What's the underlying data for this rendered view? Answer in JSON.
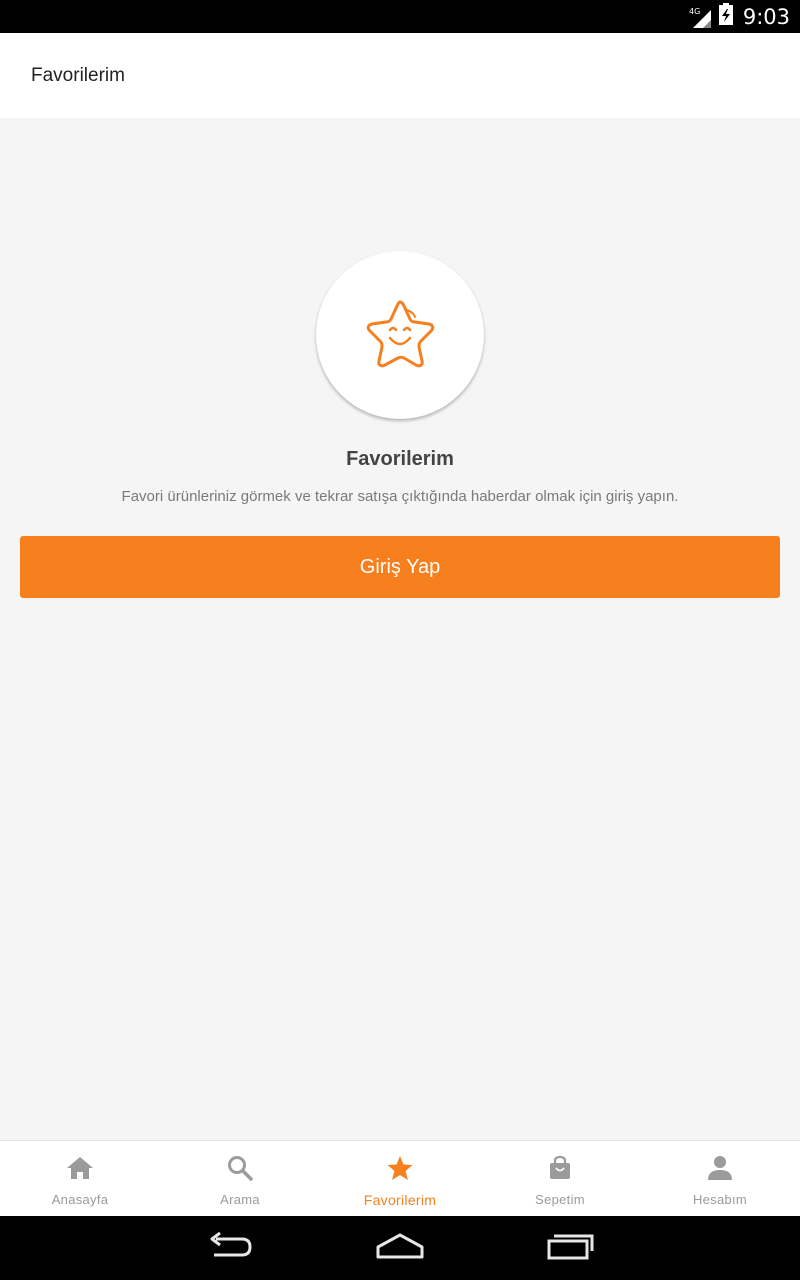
{
  "status_bar": {
    "network": "4G",
    "time": "9:03"
  },
  "app_bar": {
    "title": "Favorilerim"
  },
  "empty_state": {
    "icon": "smiling-star-icon",
    "title": "Favorilerim",
    "description": "Favori ürünleriniz görmek ve tekrar satışa çıktığında haberdar olmak için giriş yapın.",
    "button_label": "Giriş Yap"
  },
  "bottom_nav": {
    "items": [
      {
        "label": "Anasayfa",
        "icon": "home-icon",
        "active": false
      },
      {
        "label": "Arama",
        "icon": "search-icon",
        "active": false
      },
      {
        "label": "Favorilerim",
        "icon": "star-icon",
        "active": true
      },
      {
        "label": "Sepetim",
        "icon": "shopping-bag-icon",
        "active": false
      },
      {
        "label": "Hesabım",
        "icon": "person-icon",
        "active": false
      }
    ]
  },
  "system_nav": {
    "buttons": [
      "back-icon",
      "home-icon",
      "recent-apps-icon"
    ]
  },
  "colors": {
    "accent": "#f77f1e",
    "inactive": "#9b9b9b",
    "background": "#f5f5f5"
  }
}
